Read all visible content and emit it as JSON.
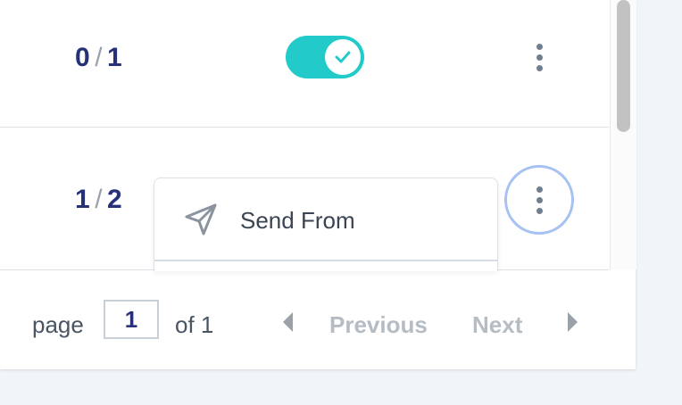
{
  "rows": [
    {
      "done": "0",
      "total": "1",
      "separator": "/",
      "toggle_on": true
    },
    {
      "done": "1",
      "total": "2",
      "separator": "/"
    }
  ],
  "dropdown": {
    "items": [
      {
        "label": "Send From",
        "icon": "send-icon"
      }
    ]
  },
  "pagination": {
    "page_word": "page",
    "current_page": "1",
    "of_text": "of 1",
    "previous_label": "Previous",
    "next_label": "Next"
  },
  "colors": {
    "accent_teal": "#22cbc9",
    "count_text": "#26317a",
    "focus_ring": "#a6c2f2",
    "disabled_text": "#b5bcc4"
  }
}
